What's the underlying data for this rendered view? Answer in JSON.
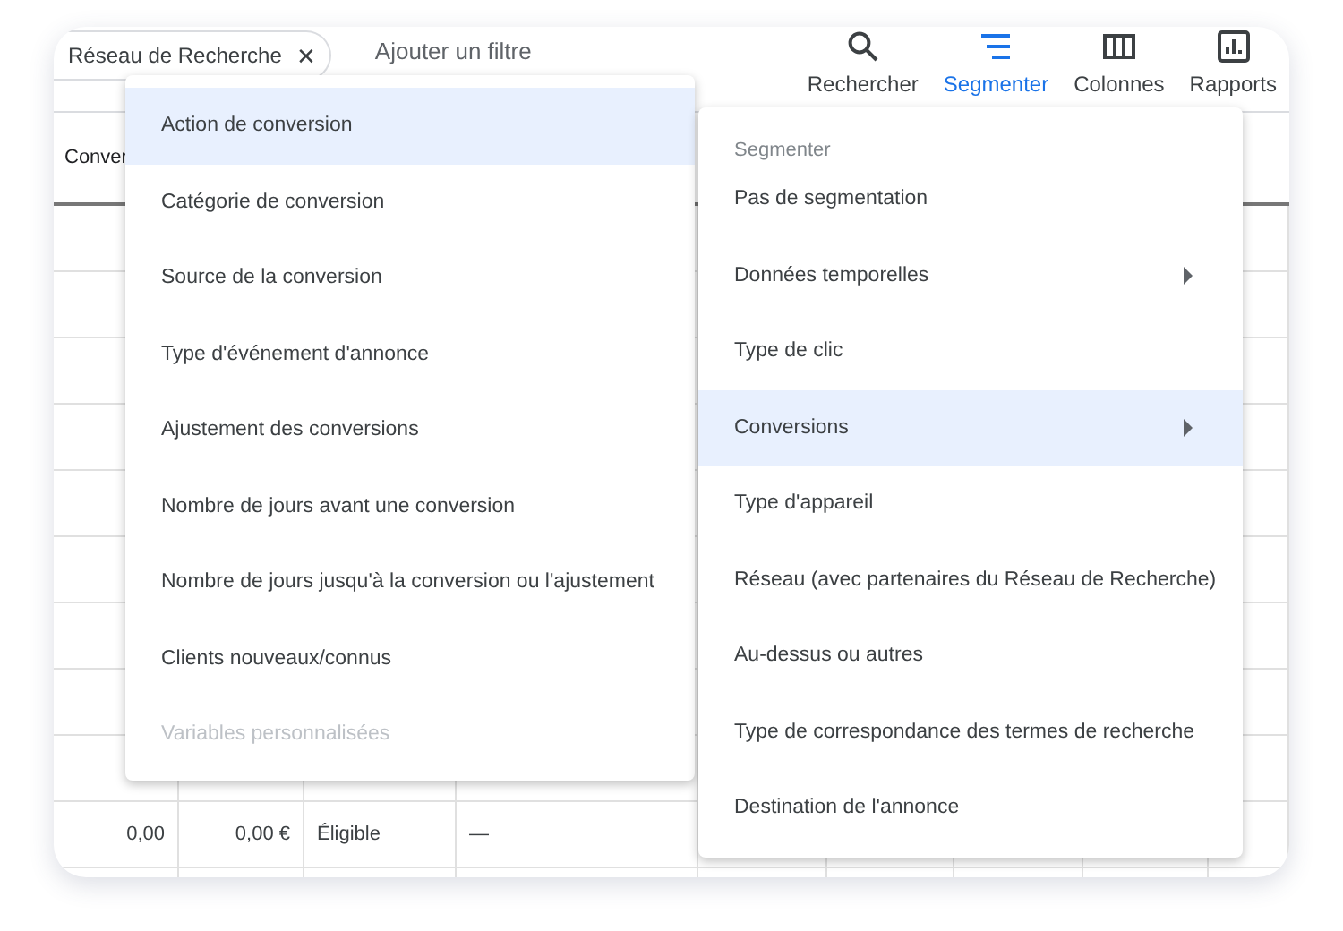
{
  "filter_chip": {
    "label": "Réseau de Recherche",
    "close": "✕"
  },
  "add_filter": {
    "placeholder": "Ajouter un filtre"
  },
  "toolbar": [
    {
      "label": "Rechercher",
      "kind": "search",
      "selected": false
    },
    {
      "label": "Segmenter",
      "kind": "segment",
      "selected": true
    },
    {
      "label": "Colonnes",
      "kind": "columns",
      "selected": false
    },
    {
      "label": "Rapports",
      "kind": "reports",
      "selected": false
    }
  ],
  "table": {
    "columns": [
      "Conver"
    ],
    "rows": [
      [
        "0,00",
        "0,00 €",
        "Éligible",
        "—"
      ]
    ]
  },
  "submenu": {
    "items": [
      {
        "label": "Action de conversion",
        "selected": true,
        "disabled": false
      },
      {
        "label": "Catégorie de conversion",
        "selected": false,
        "disabled": false
      },
      {
        "label": "Source de la conversion",
        "selected": false,
        "disabled": false
      },
      {
        "label": "Type d'événement d'annonce",
        "selected": false,
        "disabled": false
      },
      {
        "label": "Ajustement des conversions",
        "selected": false,
        "disabled": false
      },
      {
        "label": "Nombre de jours avant une conversion",
        "selected": false,
        "disabled": false
      },
      {
        "label": "Nombre de jours jusqu'à la conversion ou l'ajustement",
        "selected": false,
        "disabled": false
      },
      {
        "label": "Clients nouveaux/connus",
        "selected": false,
        "disabled": false
      },
      {
        "label": "Variables personnalisées",
        "selected": false,
        "disabled": true
      }
    ]
  },
  "segment_menu": {
    "heading": "Segmenter",
    "items": [
      {
        "label": "Pas de segmentation",
        "selected": false,
        "has_submenu": false
      },
      {
        "label": "Données temporelles",
        "selected": false,
        "has_submenu": true
      },
      {
        "label": "Type de clic",
        "selected": false,
        "has_submenu": false
      },
      {
        "label": "Conversions",
        "selected": true,
        "has_submenu": true
      },
      {
        "label": "Type d'appareil",
        "selected": false,
        "has_submenu": false
      },
      {
        "label": "Réseau (avec partenaires du Réseau de Recherche)",
        "selected": false,
        "has_submenu": false
      },
      {
        "label": "Au-dessus ou autres",
        "selected": false,
        "has_submenu": false
      },
      {
        "label": "Type de correspondance des termes de recherche",
        "selected": false,
        "has_submenu": false
      },
      {
        "label": "Destination de l'annonce",
        "selected": false,
        "has_submenu": false
      }
    ]
  }
}
